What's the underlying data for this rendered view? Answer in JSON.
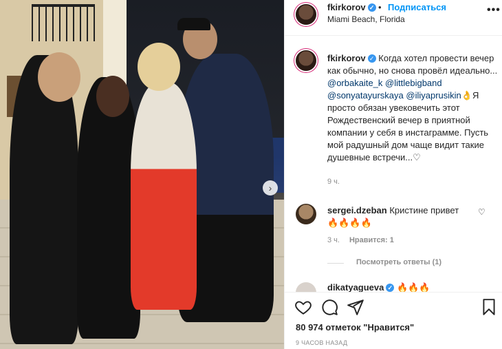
{
  "post": {
    "username": "fkirkorov",
    "follow_label": "Подписаться",
    "dot": "•",
    "location": "Miami Beach, Florida",
    "more_icon": "•••",
    "verified_icon": "✓"
  },
  "caption": {
    "username": "fkirkorov",
    "text_1": "Когда хотел провести вечер как обычно, но снова провёл идеально... ",
    "mention_1": "@orbakaite_k",
    "mention_2": "@littlebigband",
    "mention_3": "@sonyatayurskaya",
    "mention_4": "@iliyaprusikin",
    "emoji_hand": "👌",
    "text_2": "Я просто обязан увековечить этот Рождественский вечер в приятной компании у себя в инстаграмме. Пусть мой радушный дом чаще видит такие душевные встречи...",
    "emoji_heart": "♡",
    "time": "9 ч."
  },
  "comment": {
    "username": "sergei.dzeban",
    "text": "Кристине привет",
    "emojis": "🔥🔥🔥🔥",
    "time": "3 ч.",
    "likes": "Нравится: 1",
    "view_replies": "Посмотреть ответы (1)",
    "heart_icon": "♡"
  },
  "comment2": {
    "username": "dikatyagueva",
    "emojis": "🔥🔥🔥"
  },
  "actions": {
    "likes_count": "80 974 отметок \"Нравится\"",
    "post_time": "9 ЧАСОВ НАЗАД"
  },
  "photo": {
    "next_icon": "›"
  },
  "colors": {
    "accent": "#0095f6",
    "verified": "#3897f0",
    "muted": "#8e8e8e",
    "text": "#262626"
  }
}
